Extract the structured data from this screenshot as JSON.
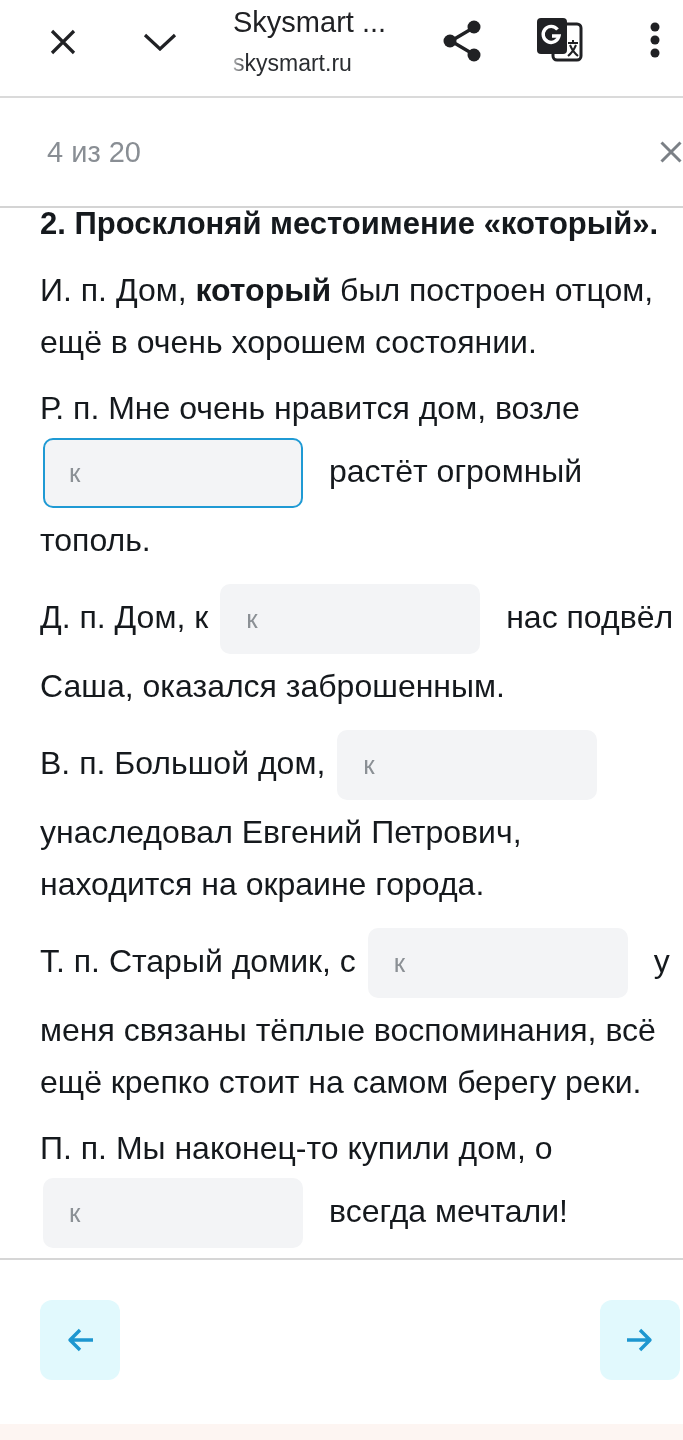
{
  "browser_bar": {
    "title": "Skysmart ...",
    "url": "skysmart.ru"
  },
  "task_header": {
    "counter": "4 из 20"
  },
  "task": {
    "heading": "2. Просклоняй местоимение «который».",
    "paragraphs": [
      {
        "parts": [
          {
            "kind": "text",
            "text": "И. п. Дом, **который** был построен отцом, ещё в очень хорошем состоянии."
          }
        ]
      },
      {
        "parts": [
          {
            "kind": "text",
            "text": "Р. п. Мне очень нравится дом, возле"
          },
          {
            "kind": "input",
            "placeholder": "к",
            "focused": true
          },
          {
            "kind": "text",
            "text": "растёт огромный"
          },
          {
            "kind": "text",
            "text": "тополь."
          }
        ]
      },
      {
        "parts": [
          {
            "kind": "text",
            "text": "Д. п. Дом, к"
          },
          {
            "kind": "input",
            "placeholder": "к",
            "focused": false
          },
          {
            "kind": "text",
            "text": "нас подвёл"
          },
          {
            "kind": "text",
            "text": "Саша, оказался заброшенным."
          }
        ]
      },
      {
        "parts": [
          {
            "kind": "text",
            "text": "В. п. Большой дом,"
          },
          {
            "kind": "input",
            "placeholder": "к",
            "focused": false
          },
          {
            "kind": "text",
            "text": "унаследовал Евгений Петрович, находится на окраине города."
          }
        ]
      },
      {
        "parts": [
          {
            "kind": "text",
            "text": "Т. п. Старый домик, с"
          },
          {
            "kind": "input",
            "placeholder": "к",
            "focused": false
          },
          {
            "kind": "text",
            "text": "у"
          },
          {
            "kind": "text",
            "text": "меня связаны тёплые воспоминания, всё ещё крепко стоит на самом берегу реки."
          }
        ]
      },
      {
        "parts": [
          {
            "kind": "text",
            "text": "П. п. Мы наконец-то купили дом, о"
          },
          {
            "kind": "input",
            "placeholder": "к",
            "focused": false
          },
          {
            "kind": "text",
            "text": "всегда мечтали!"
          }
        ]
      }
    ]
  }
}
